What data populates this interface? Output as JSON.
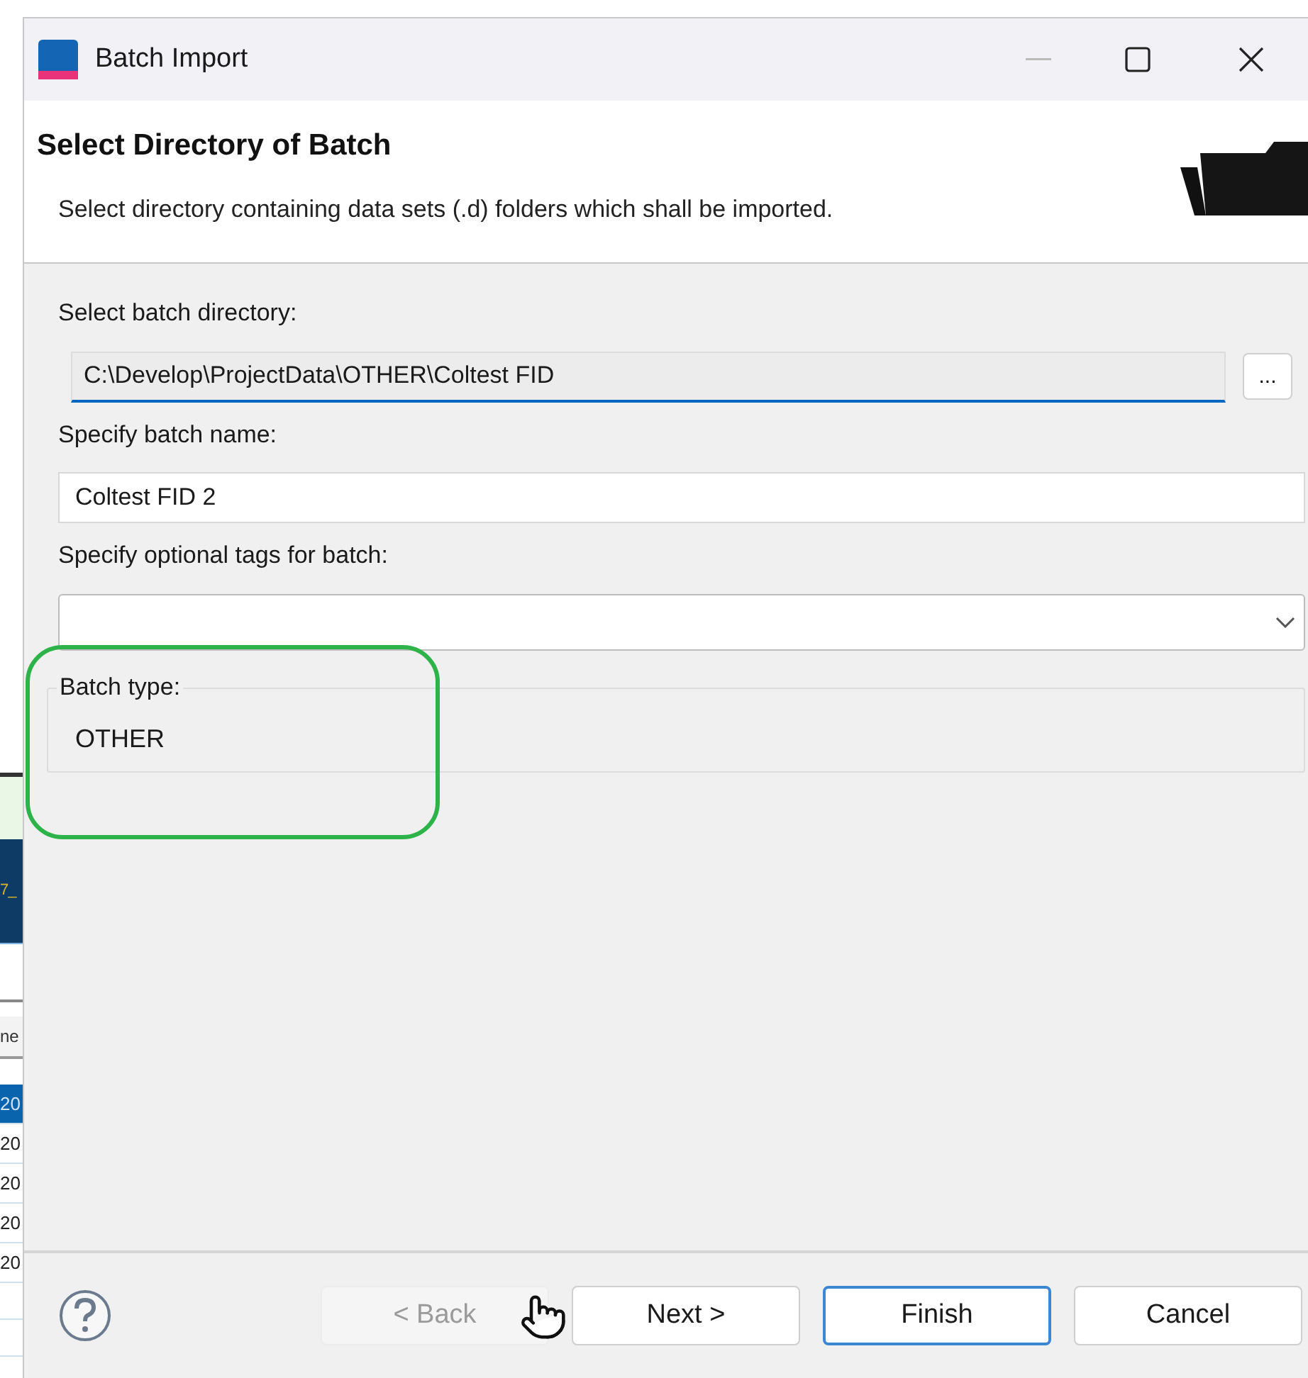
{
  "background_window": {
    "banner_text": "7_",
    "column_header": "ne",
    "rows": [
      {
        "cell": "20",
        "selected": true
      },
      {
        "cell": "20",
        "selected": false
      },
      {
        "cell": "20",
        "selected": false
      },
      {
        "cell": "20",
        "selected": false
      },
      {
        "cell": "20",
        "selected": false
      }
    ]
  },
  "window": {
    "title": "Batch Import"
  },
  "header": {
    "title": "Select Directory of Batch",
    "subtitle": "Select directory containing data sets (.d) folders which shall be imported."
  },
  "fields": [
    {
      "kind": "path",
      "label": "Select batch directory:",
      "value": "C:\\Develop\\ProjectData\\OTHER\\Coltest FID",
      "focused": true,
      "browse_label": "..."
    },
    {
      "kind": "text",
      "label": "Specify batch name:",
      "value": "Coltest FID 2"
    },
    {
      "kind": "combo",
      "label": "Specify optional tags for batch:"
    }
  ],
  "batch_type": {
    "legend": "Batch type:",
    "value": "OTHER",
    "highlighted": true
  },
  "buttons": [
    {
      "label": "< Back",
      "disabled": true,
      "default": false
    },
    {
      "label": "Next >",
      "disabled": false,
      "default": false
    },
    {
      "label": "Finish",
      "disabled": false,
      "default": true
    },
    {
      "label": "Cancel",
      "disabled": false,
      "default": false
    }
  ]
}
